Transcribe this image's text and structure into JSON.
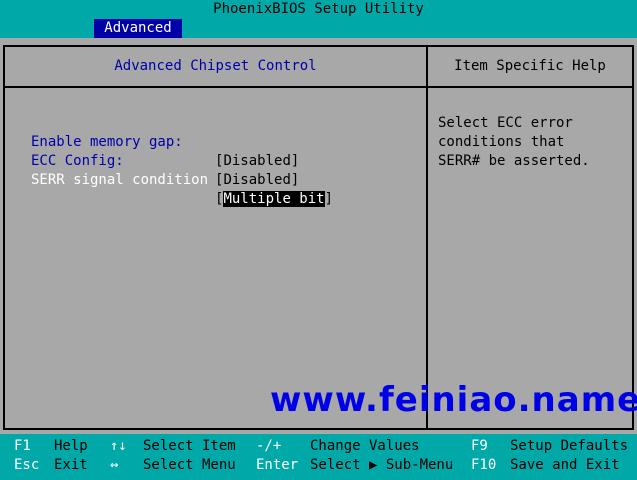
{
  "app": {
    "title": "PhoenixBIOS Setup Utility",
    "active_tab": "Advanced"
  },
  "left_panel": {
    "header": "Advanced Chipset Control",
    "items": [
      {
        "label": "Enable memory gap:",
        "value_open": "[",
        "value": "Disabled",
        "value_close": "]"
      },
      {
        "label": "ECC Config:",
        "value_open": "[",
        "value": "Disabled",
        "value_close": "]"
      },
      {
        "label": "SERR signal condition",
        "value_open": "[",
        "value": "Multiple bit",
        "value_close": "]",
        "selected": true
      }
    ]
  },
  "right_panel": {
    "header": "Item Specific Help",
    "help_lines": [
      "Select ECC error",
      "conditions that",
      "SERR# be asserted."
    ]
  },
  "watermark": "www.feiniao.name",
  "footer": {
    "row1": [
      {
        "key": "F1",
        "desc": "Help"
      },
      {
        "key": "↑↓",
        "desc": "Select Item"
      },
      {
        "key": "-/+",
        "desc": "Change Values"
      },
      {
        "key": "F9",
        "desc": "Setup Defaults"
      }
    ],
    "row2": [
      {
        "key": "Esc",
        "desc": "Exit"
      },
      {
        "key": "↔",
        "desc": "Select Menu"
      },
      {
        "key": "Enter",
        "desc": "Select ▶ Sub-Menu"
      },
      {
        "key": "F10",
        "desc": "Save and Exit"
      }
    ]
  },
  "colors": {
    "bar": "#00a8a8",
    "panel": "#a8a8a8",
    "accent_blue": "#0000a8",
    "highlight": "#000000"
  }
}
